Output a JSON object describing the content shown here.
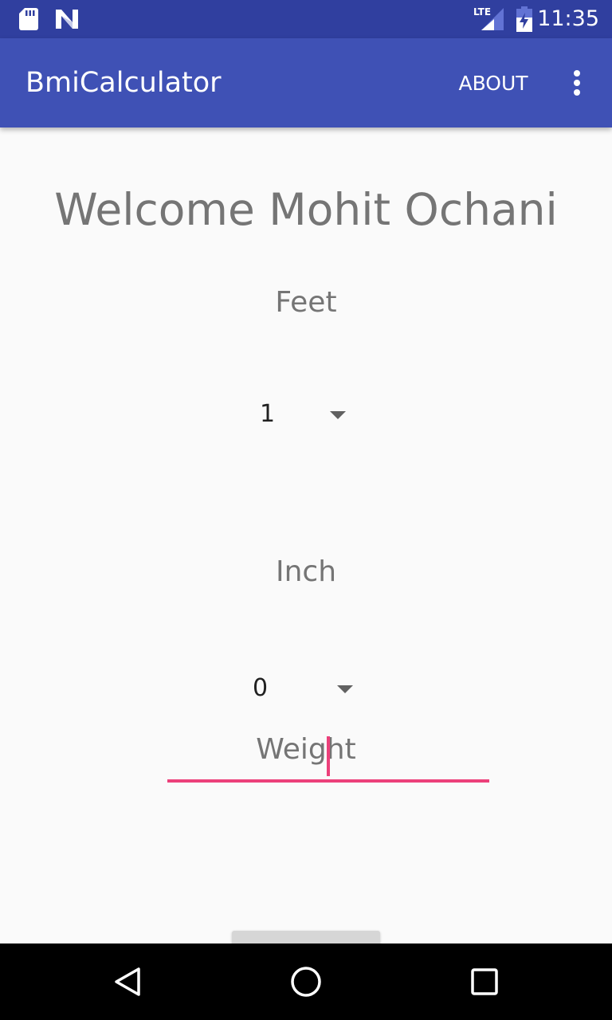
{
  "status_bar": {
    "time": "11:35",
    "left_icons": [
      "sd-card-icon",
      "n-notification-icon"
    ],
    "right_icons": [
      "lte-signal-icon",
      "battery-charging-icon"
    ],
    "signal_label": "LTE"
  },
  "app_bar": {
    "title": "BmiCalculator",
    "about_label": "ABOUT",
    "overflow_icon": "more-vert-icon"
  },
  "main": {
    "welcome": "Welcome Mohit Ochani",
    "feet_label": "Feet",
    "feet_value": "1",
    "inch_label": "Inch",
    "inch_value": "0",
    "weight_label": "Weight",
    "weight_value": ""
  },
  "nav_bar": {
    "icons": [
      "back-icon",
      "home-icon",
      "recents-icon"
    ]
  },
  "colors": {
    "status_bar": "#303F9F",
    "app_bar": "#3F51B5",
    "accent": "#EC407A",
    "background": "#FAFAFA",
    "label_text": "#757575",
    "nav_bar": "#000000"
  }
}
